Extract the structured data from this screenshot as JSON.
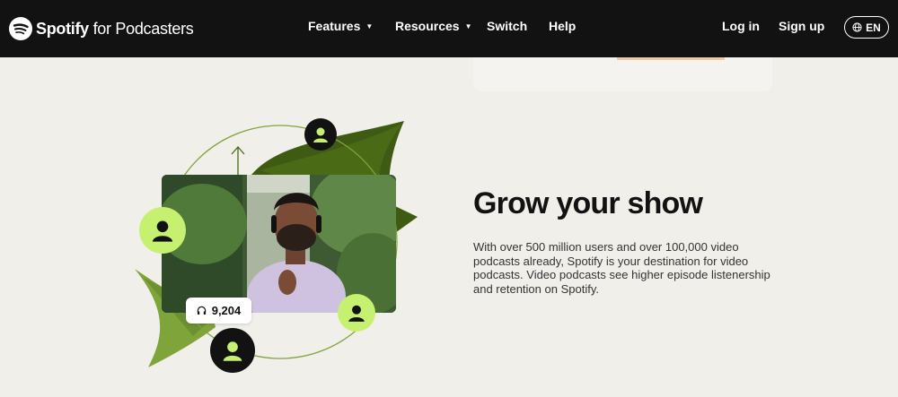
{
  "nav": {
    "logo_brand": "Spotify",
    "logo_suffix": "for Podcasters",
    "links": [
      {
        "label": "Features",
        "caret": "▼"
      },
      {
        "label": "Resources",
        "caret": "▼"
      },
      {
        "label": "Switch"
      },
      {
        "label": "Help"
      }
    ],
    "login": "Log in",
    "signup": "Sign up",
    "language": "EN"
  },
  "hero": {
    "listen_count": "9,204",
    "headline": "Grow your show",
    "body": "With over 500 million users and over 100,000 video podcasts already, Spotify is your destination for video podcasts. Video podcasts see higher episode listenership and retention on Spotify."
  },
  "colors": {
    "nav_bg": "#121212",
    "page_bg": "#f1efea",
    "accent_lime": "#c5f070",
    "leaf_green": "#3f5a12",
    "leaf_light": "#7fa43a"
  }
}
